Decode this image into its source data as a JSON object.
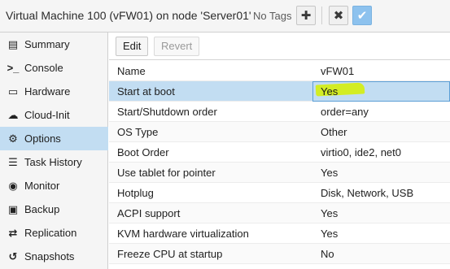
{
  "header": {
    "title": "Virtual Machine 100 (vFW01) on node 'Server01'",
    "tags_label": "No Tags"
  },
  "sidebar": {
    "items": [
      {
        "label": "Summary",
        "icon": "summary-icon",
        "glyph": "▤"
      },
      {
        "label": "Console",
        "icon": "console-icon",
        "glyph": ">_"
      },
      {
        "label": "Hardware",
        "icon": "hardware-icon",
        "glyph": "▭"
      },
      {
        "label": "Cloud-Init",
        "icon": "cloud-icon",
        "glyph": "☁"
      },
      {
        "label": "Options",
        "icon": "gear-icon",
        "glyph": "⚙"
      },
      {
        "label": "Task History",
        "icon": "list-icon",
        "glyph": "☰"
      },
      {
        "label": "Monitor",
        "icon": "eye-icon",
        "glyph": "◉"
      },
      {
        "label": "Backup",
        "icon": "floppy-icon",
        "glyph": "▣"
      },
      {
        "label": "Replication",
        "icon": "replication-icon",
        "glyph": "⇄"
      },
      {
        "label": "Snapshots",
        "icon": "history-icon",
        "glyph": "↺"
      }
    ],
    "active": "Options"
  },
  "toolbar": {
    "edit_label": "Edit",
    "revert_label": "Revert"
  },
  "options": {
    "rows": [
      {
        "name": "Name",
        "value": "vFW01"
      },
      {
        "name": "Start at boot",
        "value": "Yes"
      },
      {
        "name": "Start/Shutdown order",
        "value": "order=any"
      },
      {
        "name": "OS Type",
        "value": "Other"
      },
      {
        "name": "Boot Order",
        "value": "virtio0, ide2, net0"
      },
      {
        "name": "Use tablet for pointer",
        "value": "Yes"
      },
      {
        "name": "Hotplug",
        "value": "Disk, Network, USB"
      },
      {
        "name": "ACPI support",
        "value": "Yes"
      },
      {
        "name": "KVM hardware virtualization",
        "value": "Yes"
      },
      {
        "name": "Freeze CPU at startup",
        "value": "No"
      }
    ],
    "selected": "Start at boot"
  },
  "colors": {
    "selection": "#c2ddf2",
    "highlighter": "#d6f000",
    "confirm_button": "#8dc2ee"
  }
}
